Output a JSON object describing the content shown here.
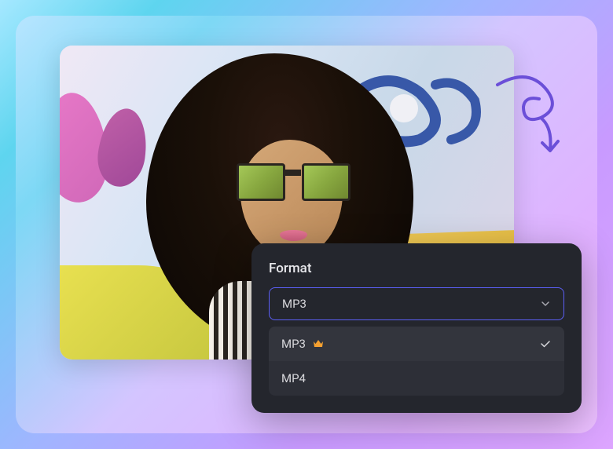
{
  "format_panel": {
    "label": "Format",
    "selected_value": "MP3",
    "options": [
      {
        "label": "MP3",
        "premium": true,
        "selected": true
      },
      {
        "label": "MP4",
        "premium": false,
        "selected": false
      }
    ]
  },
  "colors": {
    "panel_bg": "#24262d",
    "select_border": "#5b5ff5",
    "dropdown_bg": "#2d2f37",
    "item_selected_bg": "#33353d",
    "arrow_purple": "#6b4fd8"
  }
}
